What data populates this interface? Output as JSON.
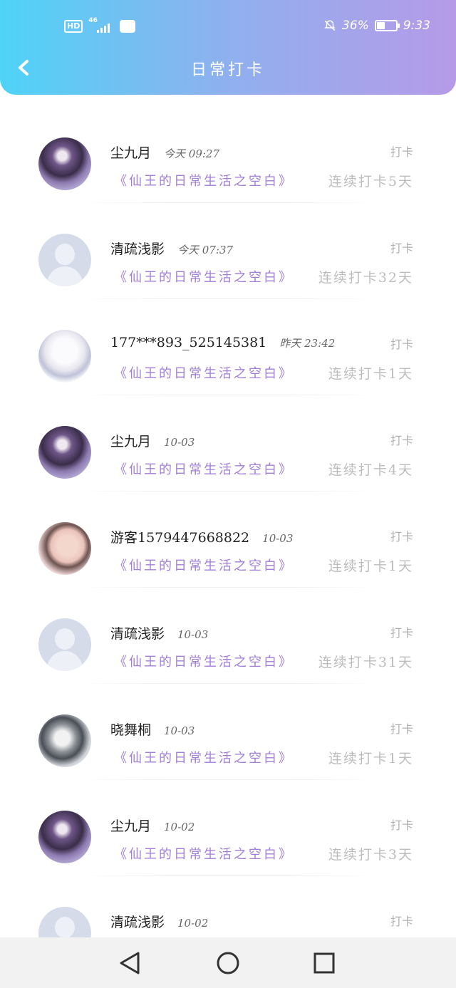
{
  "status_bar": {
    "left_hd": "HD",
    "left_network": "46",
    "right_battery_percent": "36%",
    "right_time": "9:33"
  },
  "header": {
    "title": "日常打卡"
  },
  "items": [
    {
      "name": "尘九月",
      "time": "今天 09:27",
      "type": "打卡",
      "book": "《仙王的日常生活之空白》",
      "streak": "连续打卡5天",
      "avatar": "purple"
    },
    {
      "name": "清疏浅影",
      "time": "今天 07:37",
      "type": "打卡",
      "book": "《仙王的日常生活之空白》",
      "streak": "连续打卡32天",
      "avatar": "default"
    },
    {
      "name": "177***893_525145381",
      "time": "昨天 23:42",
      "type": "打卡",
      "book": "《仙王的日常生活之空白》",
      "streak": "连续打卡1天",
      "avatar": "white"
    },
    {
      "name": "尘九月",
      "time": "10-03",
      "type": "打卡",
      "book": "《仙王的日常生活之空白》",
      "streak": "连续打卡4天",
      "avatar": "purple"
    },
    {
      "name": "游客1579447668822",
      "time": "10-03",
      "type": "打卡",
      "book": "《仙王的日常生活之空白》",
      "streak": "连续打卡1天",
      "avatar": "pink"
    },
    {
      "name": "清疏浅影",
      "time": "10-03",
      "type": "打卡",
      "book": "《仙王的日常生活之空白》",
      "streak": "连续打卡31天",
      "avatar": "default"
    },
    {
      "name": "晓舞桐",
      "time": "10-03",
      "type": "打卡",
      "book": "《仙王的日常生活之空白》",
      "streak": "连续打卡1天",
      "avatar": "grey"
    },
    {
      "name": "尘九月",
      "time": "10-02",
      "type": "打卡",
      "book": "《仙王的日常生活之空白》",
      "streak": "连续打卡3天",
      "avatar": "purple"
    },
    {
      "name": "清疏浅影",
      "time": "10-02",
      "type": "打卡",
      "book": "",
      "streak": "",
      "avatar": "default"
    }
  ],
  "icons": {
    "back": "chevron-left-icon",
    "nav_back": "triangle-back-icon",
    "nav_home": "circle-home-icon",
    "nav_recent": "square-recent-icon"
  }
}
